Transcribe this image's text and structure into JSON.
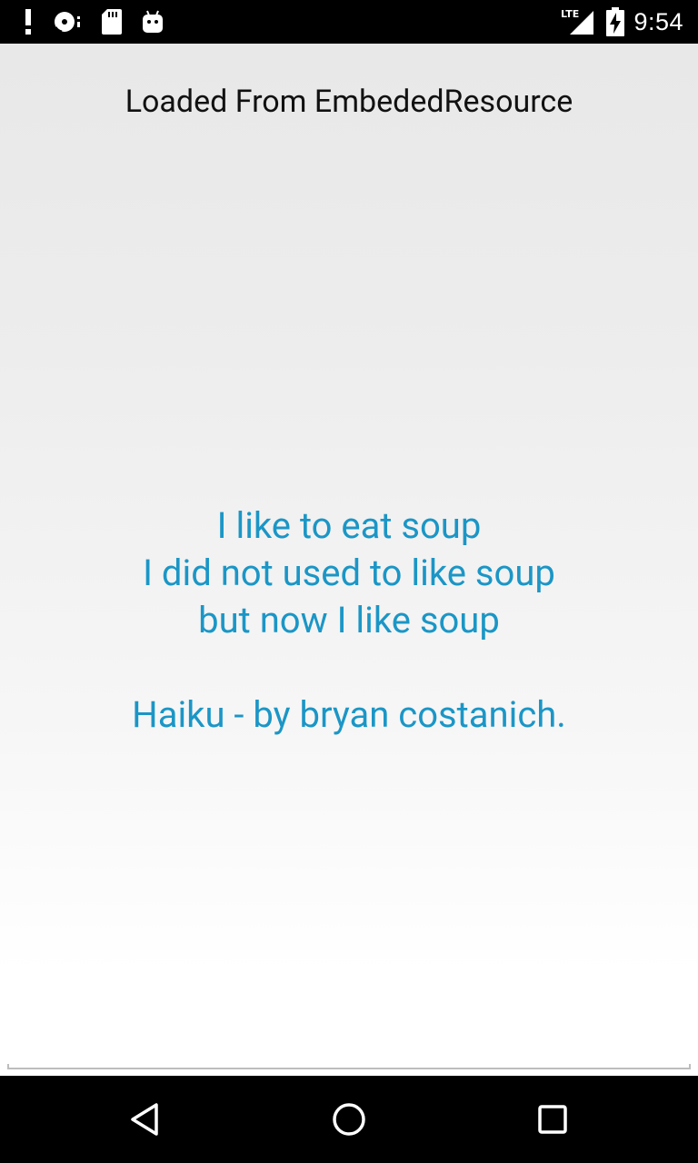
{
  "status_bar": {
    "left_icons": [
      "alert-icon",
      "disc-sync-icon",
      "sd-card-icon",
      "android-debug-icon"
    ],
    "network_label": "LTE",
    "right_icons": [
      "signal-icon",
      "battery-charging-icon"
    ],
    "time": "9:54"
  },
  "header": {
    "label": "Loaded From EmbededResource"
  },
  "haiku": {
    "line1": "I like to eat soup",
    "line2": "I did not used to like soup",
    "line3": "but now I like soup",
    "attribution": "Haiku - by bryan costanich."
  },
  "nav_bar": {
    "buttons": [
      "back-icon",
      "home-icon",
      "recents-icon"
    ]
  },
  "colors": {
    "accent": "#1b96c6",
    "status_bar": "#000000",
    "nav_bar": "#000000",
    "label_text": "#111111"
  }
}
